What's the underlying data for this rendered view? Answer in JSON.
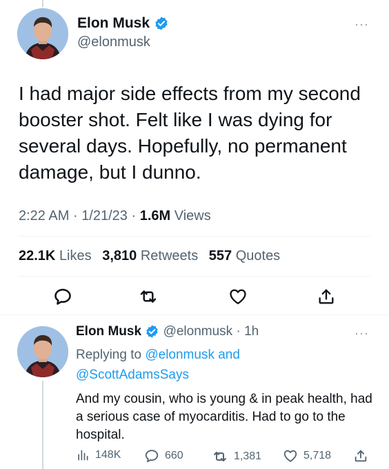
{
  "main_tweet": {
    "author_name": "Elon Musk",
    "author_handle": "@elonmusk",
    "text": "I had major side effects from my second booster shot. Felt like I was dying for several days. Hopefully, no permanent damage, but I dunno.",
    "time": "2:22 AM",
    "date": "1/21/23",
    "views_count": "1.6M",
    "views_label": "Views",
    "likes_count": "22.1K",
    "likes_label": "Likes",
    "retweets_count": "3,810",
    "retweets_label": "Retweets",
    "quotes_count": "557",
    "quotes_label": "Quotes",
    "more_label": "···"
  },
  "reply_tweet": {
    "author_name": "Elon Musk",
    "author_handle": "@elonmusk",
    "age": "1h",
    "replying_prefix": "Replying to",
    "replying_user1": "@elonmusk",
    "replying_and": "and",
    "replying_user2": "@ScottAdamsSays",
    "text": "And my cousin, who is young & in peak health, had a serious case of myocarditis. Had to go to the hospital.",
    "views": "148K",
    "replies": "660",
    "retweets": "1,381",
    "likes": "5,718",
    "more_label": "···"
  },
  "icons": [
    "avatar",
    "verified-badge-icon",
    "more-icon",
    "reply-icon",
    "retweet-icon",
    "like-icon",
    "share-icon",
    "views-icon"
  ],
  "colors": {
    "accent": "#1d9bf0",
    "secondary_text": "#536471"
  }
}
